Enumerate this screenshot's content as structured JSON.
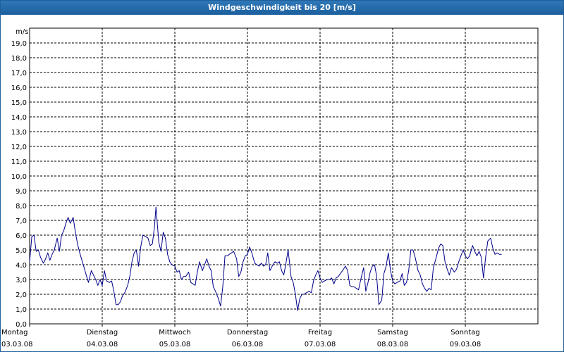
{
  "colors": {
    "title_bar": "#1c5f9e",
    "series": "#00008b",
    "grid": "#000000"
  },
  "chart_data": {
    "type": "line",
    "title": "Windgeschwindigkeit bis 20 [m/s]",
    "ylabel": "m/s",
    "xlabel": "",
    "ylim": [
      0,
      20
    ],
    "grid": true,
    "y_ticks": [
      "0,0",
      "1,0",
      "2,0",
      "3,0",
      "4,0",
      "5,0",
      "6,0",
      "7,0",
      "8,0",
      "9,0",
      "10,0",
      "11,0",
      "12,0",
      "13,0",
      "14,0",
      "15,0",
      "16,0",
      "17,0",
      "18,0",
      "19,0"
    ],
    "x_ticks": [
      {
        "day": "Montag",
        "date": "03.03.08"
      },
      {
        "day": "Dienstag",
        "date": "04.03.08"
      },
      {
        "day": "Mittwoch",
        "date": "05.03.08"
      },
      {
        "day": "Donnerstag",
        "date": "06.03.08"
      },
      {
        "day": "Freitag",
        "date": "07.03.08"
      },
      {
        "day": "Samstag",
        "date": "08.03.08"
      },
      {
        "day": "Sonntag",
        "date": "09.03.08"
      }
    ],
    "series": [
      {
        "values": [
          [
            0.0,
            4.2
          ],
          [
            0.03,
            5.9
          ],
          [
            0.06,
            6.0
          ],
          [
            0.09,
            4.9
          ],
          [
            0.12,
            5.0
          ],
          [
            0.15,
            4.5
          ],
          [
            0.19,
            4.1
          ],
          [
            0.22,
            4.4
          ],
          [
            0.25,
            4.8
          ],
          [
            0.28,
            4.3
          ],
          [
            0.31,
            4.7
          ],
          [
            0.34,
            5.0
          ],
          [
            0.38,
            5.8
          ],
          [
            0.41,
            4.9
          ],
          [
            0.44,
            6.0
          ],
          [
            0.47,
            6.3
          ],
          [
            0.5,
            6.8
          ],
          [
            0.53,
            7.2
          ],
          [
            0.56,
            6.8
          ],
          [
            0.6,
            7.2
          ],
          [
            0.63,
            6.2
          ],
          [
            0.66,
            5.4
          ],
          [
            0.69,
            4.8
          ],
          [
            0.72,
            4.3
          ],
          [
            0.75,
            3.8
          ],
          [
            0.78,
            3.3
          ],
          [
            0.81,
            2.8
          ],
          [
            0.85,
            3.6
          ],
          [
            0.88,
            3.3
          ],
          [
            0.91,
            3.0
          ],
          [
            0.94,
            2.6
          ],
          [
            0.97,
            3.0
          ],
          [
            1.0,
            2.6
          ],
          [
            1.03,
            3.6
          ],
          [
            1.06,
            2.9
          ],
          [
            1.1,
            2.8
          ],
          [
            1.13,
            2.9
          ],
          [
            1.16,
            2.2
          ],
          [
            1.19,
            1.3
          ],
          [
            1.22,
            1.3
          ],
          [
            1.25,
            1.5
          ],
          [
            1.28,
            1.9
          ],
          [
            1.31,
            2.1
          ],
          [
            1.35,
            2.6
          ],
          [
            1.38,
            3.2
          ],
          [
            1.41,
            4.2
          ],
          [
            1.44,
            4.8
          ],
          [
            1.47,
            5.0
          ],
          [
            1.5,
            3.9
          ],
          [
            1.53,
            5.2
          ],
          [
            1.56,
            6.0
          ],
          [
            1.6,
            5.9
          ],
          [
            1.63,
            5.8
          ],
          [
            1.66,
            5.3
          ],
          [
            1.69,
            5.4
          ],
          [
            1.72,
            6.6
          ],
          [
            1.74,
            7.9
          ],
          [
            1.78,
            5.5
          ],
          [
            1.81,
            4.9
          ],
          [
            1.84,
            6.2
          ],
          [
            1.87,
            5.8
          ],
          [
            1.9,
            4.7
          ],
          [
            1.93,
            4.2
          ],
          [
            1.96,
            4.0
          ],
          [
            2.0,
            3.9
          ],
          [
            2.03,
            3.5
          ],
          [
            2.06,
            3.6
          ],
          [
            2.09,
            3.0
          ],
          [
            2.12,
            3.2
          ],
          [
            2.15,
            3.2
          ],
          [
            2.19,
            3.5
          ],
          [
            2.22,
            2.8
          ],
          [
            2.25,
            2.7
          ],
          [
            2.28,
            2.6
          ],
          [
            2.31,
            3.5
          ],
          [
            2.34,
            4.2
          ],
          [
            2.38,
            3.6
          ],
          [
            2.41,
            4.0
          ],
          [
            2.44,
            4.4
          ],
          [
            2.47,
            3.9
          ],
          [
            2.5,
            3.6
          ],
          [
            2.53,
            2.5
          ],
          [
            2.56,
            2.2
          ],
          [
            2.6,
            1.7
          ],
          [
            2.63,
            1.2
          ],
          [
            2.66,
            2.5
          ],
          [
            2.69,
            4.6
          ],
          [
            2.72,
            4.6
          ],
          [
            2.75,
            4.7
          ],
          [
            2.78,
            4.8
          ],
          [
            2.81,
            4.9
          ],
          [
            2.85,
            4.4
          ],
          [
            2.88,
            3.2
          ],
          [
            2.91,
            3.5
          ],
          [
            2.94,
            4.2
          ],
          [
            2.97,
            4.6
          ],
          [
            3.0,
            4.7
          ],
          [
            3.03,
            5.2
          ],
          [
            3.06,
            4.8
          ],
          [
            3.1,
            4.1
          ],
          [
            3.13,
            4.0
          ],
          [
            3.16,
            3.9
          ],
          [
            3.19,
            4.1
          ],
          [
            3.22,
            3.9
          ],
          [
            3.25,
            4.0
          ],
          [
            3.28,
            4.8
          ],
          [
            3.31,
            3.6
          ],
          [
            3.35,
            4.0
          ],
          [
            3.38,
            4.2
          ],
          [
            3.41,
            4.1
          ],
          [
            3.44,
            4.2
          ],
          [
            3.47,
            3.6
          ],
          [
            3.5,
            3.3
          ],
          [
            3.53,
            4.1
          ],
          [
            3.56,
            5.0
          ],
          [
            3.6,
            3.2
          ],
          [
            3.63,
            2.8
          ],
          [
            3.66,
            2.0
          ],
          [
            3.69,
            0.9
          ],
          [
            3.72,
            1.7
          ],
          [
            3.75,
            2.0
          ],
          [
            3.78,
            2.0
          ],
          [
            3.81,
            2.1
          ],
          [
            3.85,
            2.2
          ],
          [
            3.88,
            2.1
          ],
          [
            3.91,
            2.9
          ],
          [
            3.94,
            3.3
          ],
          [
            3.97,
            3.6
          ],
          [
            4.0,
            3.1
          ],
          [
            4.03,
            2.8
          ],
          [
            4.06,
            2.9
          ],
          [
            4.1,
            3.0
          ],
          [
            4.13,
            3.0
          ],
          [
            4.16,
            3.1
          ],
          [
            4.19,
            2.7
          ],
          [
            4.22,
            3.1
          ],
          [
            4.25,
            3.2
          ],
          [
            4.28,
            3.4
          ],
          [
            4.31,
            3.6
          ],
          [
            4.35,
            3.9
          ],
          [
            4.38,
            3.6
          ],
          [
            4.41,
            2.6
          ],
          [
            4.44,
            2.5
          ],
          [
            4.47,
            2.5
          ],
          [
            4.5,
            2.4
          ],
          [
            4.53,
            2.3
          ],
          [
            4.56,
            3.0
          ],
          [
            4.6,
            3.8
          ],
          [
            4.63,
            2.2
          ],
          [
            4.66,
            2.8
          ],
          [
            4.69,
            3.5
          ],
          [
            4.72,
            3.9
          ],
          [
            4.75,
            4.0
          ],
          [
            4.78,
            3.2
          ],
          [
            4.81,
            1.3
          ],
          [
            4.85,
            1.6
          ],
          [
            4.88,
            3.4
          ],
          [
            4.91,
            3.9
          ],
          [
            4.94,
            4.8
          ],
          [
            4.97,
            3.6
          ],
          [
            5.0,
            2.9
          ],
          [
            5.03,
            2.7
          ],
          [
            5.06,
            2.8
          ],
          [
            5.1,
            2.9
          ],
          [
            5.13,
            3.4
          ],
          [
            5.16,
            2.6
          ],
          [
            5.19,
            2.8
          ],
          [
            5.22,
            3.6
          ],
          [
            5.25,
            5.0
          ],
          [
            5.28,
            5.0
          ],
          [
            5.31,
            4.5
          ],
          [
            5.35,
            3.6
          ],
          [
            5.38,
            3.3
          ],
          [
            5.41,
            2.7
          ],
          [
            5.44,
            2.4
          ],
          [
            5.47,
            2.2
          ],
          [
            5.5,
            2.4
          ],
          [
            5.53,
            2.3
          ],
          [
            5.56,
            3.8
          ],
          [
            5.6,
            4.5
          ],
          [
            5.63,
            5.1
          ],
          [
            5.66,
            5.4
          ],
          [
            5.69,
            5.3
          ],
          [
            5.72,
            4.2
          ],
          [
            5.75,
            3.7
          ],
          [
            5.78,
            3.3
          ],
          [
            5.81,
            3.8
          ],
          [
            5.85,
            3.5
          ],
          [
            5.88,
            3.7
          ],
          [
            5.91,
            4.2
          ],
          [
            5.94,
            4.6
          ],
          [
            5.97,
            5.0
          ],
          [
            6.0,
            4.6
          ],
          [
            6.03,
            4.4
          ],
          [
            6.06,
            4.6
          ],
          [
            6.1,
            5.3
          ],
          [
            6.13,
            4.9
          ],
          [
            6.16,
            4.6
          ],
          [
            6.19,
            4.9
          ],
          [
            6.22,
            4.5
          ],
          [
            6.25,
            3.1
          ],
          [
            6.28,
            4.5
          ],
          [
            6.31,
            5.6
          ],
          [
            6.35,
            5.8
          ],
          [
            6.38,
            5.1
          ],
          [
            6.41,
            4.7
          ],
          [
            6.44,
            4.8
          ],
          [
            6.47,
            4.7
          ],
          [
            6.5,
            4.7
          ]
        ]
      }
    ]
  }
}
